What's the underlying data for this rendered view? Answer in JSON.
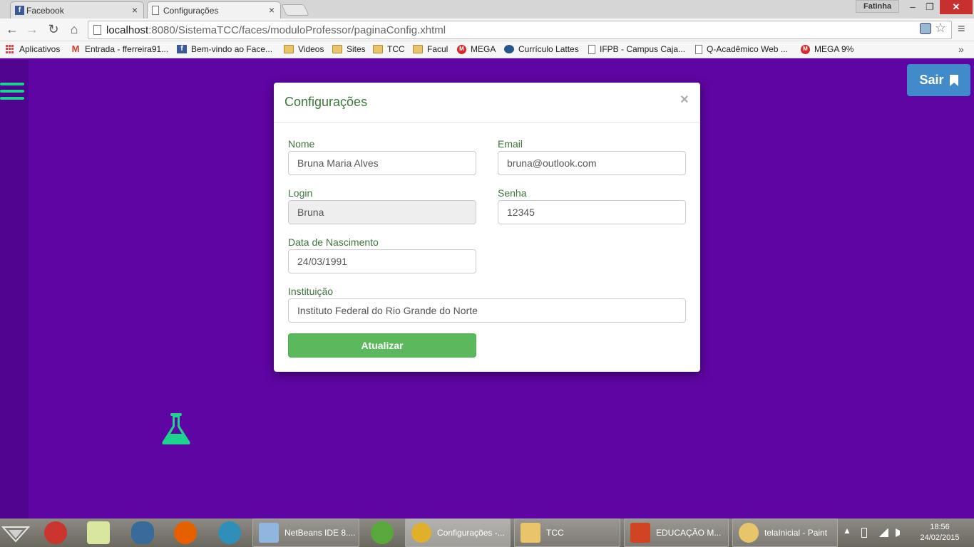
{
  "browser": {
    "tabs": [
      {
        "title": "Facebook",
        "close": "×"
      },
      {
        "title": "Configurações",
        "close": "×"
      }
    ],
    "user": "Fatinha",
    "window_controls": {
      "minimize": "–",
      "maximize": "❐",
      "close": "✕"
    },
    "nav": {
      "back": "←",
      "forward": "→",
      "reload": "↻",
      "home": "⌂",
      "menu": "≡",
      "star": "☆"
    },
    "url": {
      "host": "localhost",
      "rest": ":8080/SistemaTCC/faces/moduloProfessor/paginaConfig.xhtml"
    },
    "bookmarks": [
      {
        "label": "Aplicativos",
        "icon": "apps-icon"
      },
      {
        "label": "Entrada - fferreira91...",
        "icon": "gmail-icon"
      },
      {
        "label": "Bem-vindo ao Face...",
        "icon": "facebook-icon"
      },
      {
        "label": "Videos",
        "icon": "folder-icon"
      },
      {
        "label": "Sites",
        "icon": "folder-icon"
      },
      {
        "label": "TCC",
        "icon": "folder-icon"
      },
      {
        "label": "Facul",
        "icon": "folder-icon"
      },
      {
        "label": "MEGA",
        "icon": "mega-icon"
      },
      {
        "label": "Currículo Lattes",
        "icon": "lattes-icon"
      },
      {
        "label": "IFPB - Campus Caja...",
        "icon": "page-icon"
      },
      {
        "label": "Q-Acadêmico Web ...",
        "icon": "page-icon"
      },
      {
        "label": "MEGA 9%",
        "icon": "mega-icon"
      }
    ],
    "bookmarks_more": "»"
  },
  "page": {
    "logout_label": "Sair",
    "modal": {
      "title": "Configurações",
      "close": "×",
      "fields": {
        "nome": {
          "label": "Nome",
          "value": "Bruna Maria Alves"
        },
        "email": {
          "label": "Email",
          "value": "bruna@outlook.com"
        },
        "login": {
          "label": "Login",
          "value": "Bruna"
        },
        "senha": {
          "label": "Senha",
          "value": "12345"
        },
        "nascimento": {
          "label": "Data de Nascimento",
          "value": "24/03/1991"
        },
        "instituicao": {
          "label": "Instituição",
          "value": "Instituto Federal do Rio Grande do Norte"
        }
      },
      "submit_label": "Atualizar"
    },
    "colors": {
      "background": "#5f05a3",
      "sidebar": "#50038e",
      "accent": "#1dd48e",
      "label": "#3c763d",
      "submit": "#5cb85c",
      "logout": "#428bca"
    }
  },
  "taskbar": {
    "items": [
      {
        "label": "NetBeans IDE 8....",
        "icon": "netbeans-icon"
      },
      {
        "label": "Configurações -...",
        "icon": "chrome-icon"
      },
      {
        "label": "TCC",
        "icon": "folder-icon"
      },
      {
        "label": "EDUCAÇÃO  M...",
        "icon": "powerpoint-icon"
      },
      {
        "label": "telaInicial - Paint",
        "icon": "paint-icon"
      }
    ],
    "tray_arrow": "▲",
    "time": "18:56",
    "date": "24/02/2015"
  }
}
